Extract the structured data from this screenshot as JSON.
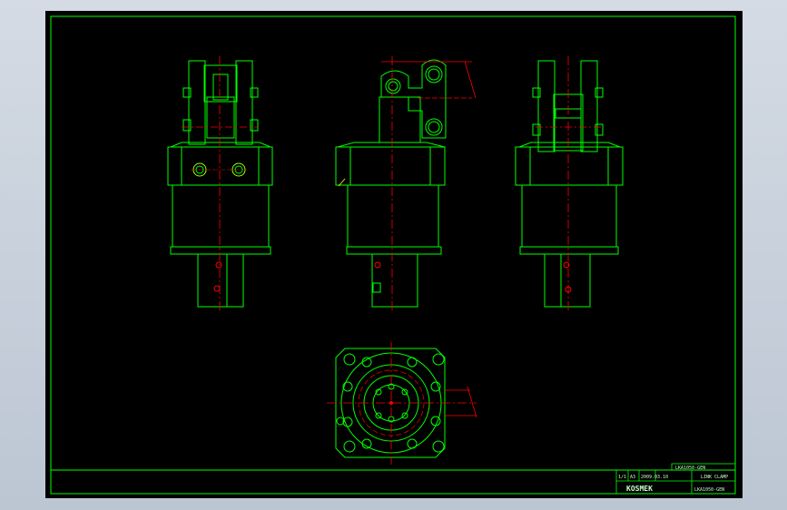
{
  "drawing": {
    "title": "LINK CLAMP",
    "drawing_number": "LKA1050-GEN",
    "top_code": "LKA1050-GEN",
    "sheet": "1/1",
    "size": "A3",
    "date": "2009.03.10",
    "logo_text": "KOSMEK"
  },
  "colors": {
    "background": "#000000",
    "outline": "#00ff00",
    "centerline": "#ff0000",
    "accent": "#ffff00",
    "frame": "#00ff00"
  },
  "views": [
    {
      "name": "front-view"
    },
    {
      "name": "side-view"
    },
    {
      "name": "rear-view"
    },
    {
      "name": "bottom-view"
    }
  ]
}
